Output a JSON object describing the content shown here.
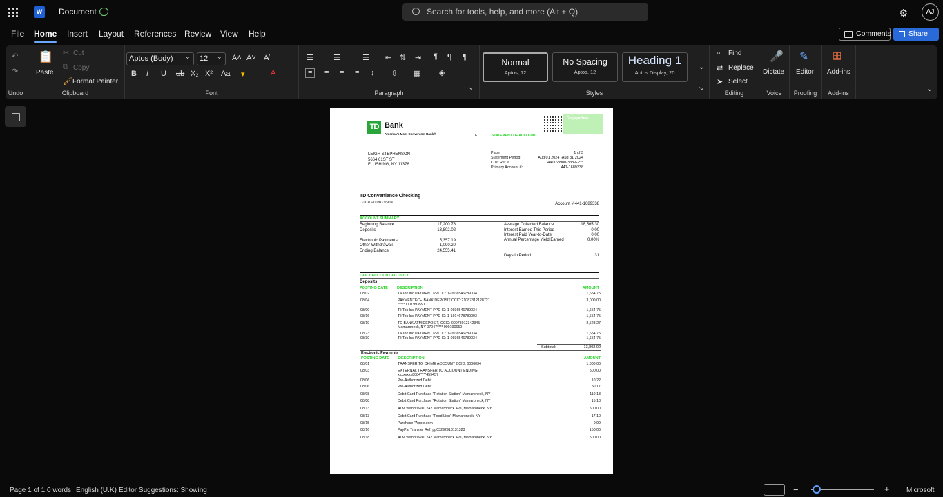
{
  "app": {
    "title": "Document",
    "search_placeholder": "Search for tools, help, and more (Alt + Q)",
    "avatar": "AJ",
    "word_logo": "W"
  },
  "menu": [
    "File",
    "Home",
    "Insert",
    "Layout",
    "References",
    "Review",
    "View",
    "Help"
  ],
  "actions": {
    "comments": "Comments",
    "share": "Share"
  },
  "ribbon": {
    "undo_label": "Undo",
    "clipboard": {
      "label": "Clipboard",
      "paste": "Paste",
      "cut": "Cut",
      "copy": "Copy",
      "format_painter": "Format Painter"
    },
    "font": {
      "label": "Font",
      "name": "Aptos (Body)",
      "size": "12"
    },
    "paragraph": {
      "label": "Paragraph"
    },
    "styles": {
      "label": "Styles",
      "items": [
        {
          "name": "Normal",
          "sub": "Aptos, 12"
        },
        {
          "name": "No Spacing",
          "sub": "Aptos, 12"
        },
        {
          "name": "Heading 1",
          "sub": "Aptos Display, 20"
        }
      ]
    },
    "editing": {
      "label": "Editing",
      "find": "Find",
      "replace": "Replace",
      "select": "Select"
    },
    "voice": {
      "label": "Voice",
      "dictate": "Dictate"
    },
    "proofing": {
      "label": "Proofing",
      "editor": "Editor"
    },
    "addins": {
      "label": "Add-ins",
      "addins": "Add-ins"
    }
  },
  "statement": {
    "bank": "Bank",
    "tagline": "America's Most Convenient Bank®",
    "logo": "TD",
    "go_paperless": "Go paperless.",
    "title": "STATEMENT OF ACCOUNT",
    "marker": "E",
    "address": [
      "LEIGH STEPHENSON",
      "5664 61ST ST",
      "FLUSHING, NY 11378"
    ],
    "meta": [
      {
        "k": "Page:",
        "v": "1 of 3"
      },
      {
        "k": "Statement Period:",
        "v": "Aug 01 2024 -Aug 31 2024"
      },
      {
        "k": "Cust Ref #:",
        "v": "441168900-338-E-***"
      },
      {
        "k": "Primary Account #:",
        "v": "441-1689338"
      }
    ],
    "product": "TD Convenience Checking",
    "holder": "LEIGH STEPHENSON",
    "account": "Account # 441-1689338",
    "summary_header": "ACCOUNT SUMMARY",
    "summary_left": [
      {
        "k": "Beginning Balance",
        "v": "17,200.78"
      },
      {
        "k": "Deposits",
        "v": "13,802.02"
      },
      {
        "k": "Electronic Payments",
        "v": "5,357.19"
      },
      {
        "k": "Other Withdrawals",
        "v": "1,090.20"
      },
      {
        "k": "Ending Balance",
        "v": "24,555.41"
      }
    ],
    "summary_right": [
      {
        "k": "Average Collected Balance",
        "v": "18,565.30"
      },
      {
        "k": "Interest Earned This Period",
        "v": "0.00"
      },
      {
        "k": "Interest Paid Year-to-Date",
        "v": "0.00"
      },
      {
        "k": "Annual Percentage Yield Earned",
        "v": "0.00%"
      },
      {
        "k": "Days in Period",
        "v": "31"
      }
    ],
    "daily_header": "DAILY ACCOUNT ACTIVITY",
    "deposits_title": "Deposits",
    "col_date": "POSTING DATE",
    "col_desc": "DESCRIPTION",
    "col_amount": "AMOUNT",
    "deposits": [
      {
        "d": "08/02",
        "desc": "TikTok Inc PAYMENT PPD ID: 1-0936546789034",
        "a": "1,654.75"
      },
      {
        "d": "08/04",
        "desc": "PAYMENTECH BANK DEPOSIT CCID:21087312128721",
        "desc2": "*****0001993551",
        "a": "3,000.00"
      },
      {
        "d": "08/09",
        "desc": "TikTok Inc PAYMENT PPD ID: 1-0936546789034",
        "a": "1,654.75"
      },
      {
        "d": "08/16",
        "desc": "TikTok Inc PAYMENT PPD ID: 1-1914678789093",
        "a": "1,654.75"
      },
      {
        "d": "08/19",
        "desc": "TD BANK ATM DEPOSIT, CCID: 00078012342345",
        "desc2": "Mamaroneck, NY 07047**** 000190650",
        "a": "2,528.27"
      },
      {
        "d": "08/23",
        "desc": "TikTok Inc PAYMENT PPD ID: 1-0936546789034",
        "a": "1,654.75"
      },
      {
        "d": "08/30",
        "desc": "TikTok Inc PAYMENT PPD ID: 1-0936546789034",
        "a": "1,654.75"
      }
    ],
    "subtotal_label": "Subtotal:",
    "subtotal": "13,802.02",
    "epay_title": "Electronic Payments",
    "epay": [
      {
        "d": "08/01",
        "desc": "TRANSFER TO CHIME ACCOUNT CCID: 0000034",
        "a": "1,000.00"
      },
      {
        "d": "08/03",
        "desc": "EXTERNAL TRANSFER  TO ACCOUNT ENDING",
        "desc2": "xxxxxxxx8084****459457",
        "a": "500.00"
      },
      {
        "d": "08/06",
        "desc": "Pre-Authorized Debit",
        "a": "10.22"
      },
      {
        "d": "08/06",
        "desc": "Pre-Authorized Debit",
        "a": "50.17"
      },
      {
        "d": "08/08",
        "desc": "Debit Card Purchase \"Rotation Station\" Mamaroneck, NY",
        "a": "110.13"
      },
      {
        "d": "08/08",
        "desc": "Debit Card Purchase \"Rotation Station\" Mamaroneck, NY",
        "a": "15.13"
      },
      {
        "d": "08/13",
        "desc": "ATM Withdrawal, 242 Mamaroneck Ave, Mamaroneck, NY",
        "a": "500.00"
      },
      {
        "d": "08/13",
        "desc": "Debit Card Purchase \"Food Lion\" Mamaroneck, NY",
        "a": "17.10"
      },
      {
        "d": "08/15",
        "desc": "Purchase \"Apple.com",
        "a": "9.99"
      },
      {
        "d": "08/16",
        "desc": "PayPal Transfer Ref: pp03292913131323",
        "a": "150.00"
      },
      {
        "d": "08/18",
        "desc": "ATM Withdrawal, 242 Mamaroneck Ave, Mamaroneck, NY",
        "a": "500.00"
      }
    ]
  },
  "status": {
    "page": "Page 1 of 1",
    "words": "0 words",
    "lang": "English (U.K)",
    "editor": "Editor Suggestions: Showing",
    "minus": "−",
    "plus": "+",
    "brand": "Microsoft"
  }
}
